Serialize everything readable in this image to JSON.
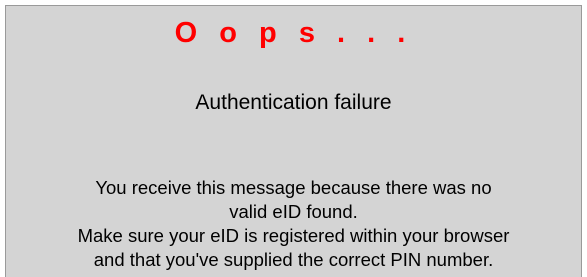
{
  "error_page": {
    "title": "O o p s . . .",
    "heading": "Authentication failure",
    "message_lines": [
      "You receive this message because there was no",
      "valid eID found.",
      "Make sure your eID is registered within your browser",
      "and that you've supplied the correct PIN number."
    ]
  },
  "colors": {
    "title": "#ff0000",
    "background": "#d4d4d4",
    "text": "#000000"
  }
}
